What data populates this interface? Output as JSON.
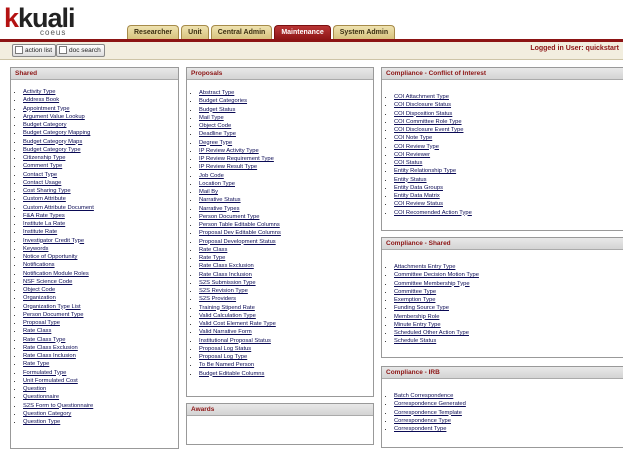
{
  "header": {
    "logo_text_main": "kuali",
    "logo_text_sub": "coeus",
    "tabs": [
      {
        "label": "Researcher"
      },
      {
        "label": "Unit"
      },
      {
        "label": "Central Admin"
      },
      {
        "label": "Maintenance"
      },
      {
        "label": "System Admin"
      }
    ],
    "active_tab": "Maintenance"
  },
  "toolbar": {
    "action_list_label": "action list",
    "doc_search_label": "doc search",
    "login_text": "Logged in User: quickstart"
  },
  "panels": {
    "shared": {
      "title": "Shared",
      "items": [
        "Activity Type",
        "Address Book",
        "Appointment Type",
        "Argument Value Lookup",
        "Budget Category",
        "Budget Category Mapping",
        "Budget Category Maps",
        "Budget Category Type",
        "Citizenship Type",
        "Comment Type",
        "Contact Type",
        "Contact Usage",
        "Cost Sharing Type",
        "Custom Attribute",
        "Custom Attribute Document",
        "F&A Rate Types",
        "Institute La Rate",
        "Institute Rate",
        "Investigator Credit Type",
        "Keywords",
        "Notice of Opportunity",
        "Notifications",
        "Notification Module Roles",
        "NSF Science Code",
        "Object Code",
        "Organization",
        "Organization Type List",
        "Person Document Type",
        "Proposal Type",
        "Rate Class",
        "Rate Class Type",
        "Rate Class Exclusion",
        "Rate Class Inclusion",
        "Rate Type",
        "Formulated Type",
        "Unit Formulated Cost",
        "Question",
        "Questionnaire",
        "S2S Form to Questionnaire",
        "Question Category",
        "Question Type"
      ]
    },
    "proposals": {
      "title": "Proposals",
      "items": [
        "Abstract Type",
        "Budget Categories",
        "Budget Status",
        "Mail Type",
        "Object Code",
        "Deadline Type",
        "Degree Type",
        "IP Review Activity Type",
        "IP Review Requirement Type",
        "IP Review Result Type",
        "Job Code",
        "Location Type",
        "Mail By",
        "Narrative Status",
        "Narrative Types",
        "Person Document Type",
        "Person Table Editable Columns",
        "Proposal Dev Editable Columns",
        "Proposal Development Status",
        "Rate Class",
        "Rate Type",
        "Rate Class Exclusion",
        "Rate Class Inclusion",
        "S2S Submission Type",
        "S2S Revision Type",
        "S2S Providers",
        "Training Stipend Rate",
        "Valid Calculation Type",
        "Valid Cost Element Rate Type",
        "Valid Narrative Form",
        "Institutional Proposal Status",
        "Proposal Log Status",
        "Proposal Log Type",
        "To Be Named Person",
        "Budget Editable Columns"
      ]
    },
    "awards": {
      "title": "Awards",
      "items": []
    },
    "coi": {
      "title": "Compliance - Conflict of Interest",
      "items": [
        "COI Attachment Type",
        "COI Disclosure Status",
        "COI Disposition Status",
        "COI Committee Role Type",
        "COI Disclosure Event Type",
        "COI Note Type",
        "COI Review Type",
        "COI Reviewer",
        "COI Status",
        "Entity Relationship Type",
        "Entity Status",
        "Entity Data Groups",
        "Entity Data Matrix",
        "COI Review Status",
        "COI Recomended Action Type"
      ]
    },
    "compliance_shared": {
      "title": "Compliance - Shared",
      "items": [
        "Attachments Entry Type",
        "Committee Decision Motion Type",
        "Committee Membership Type",
        "Committee Type",
        "Exemption Type",
        "Funding Source Type",
        "Membership Role",
        "Minute Entry Type",
        "Scheduled Other Action Type",
        "Schedule Status"
      ]
    },
    "irb": {
      "title": "Compliance - IRB",
      "items": [
        "Batch Correspondence",
        "Correspondence Generated",
        "Correspondence Template",
        "Correspondence Type",
        "Correspondent Type"
      ]
    }
  }
}
